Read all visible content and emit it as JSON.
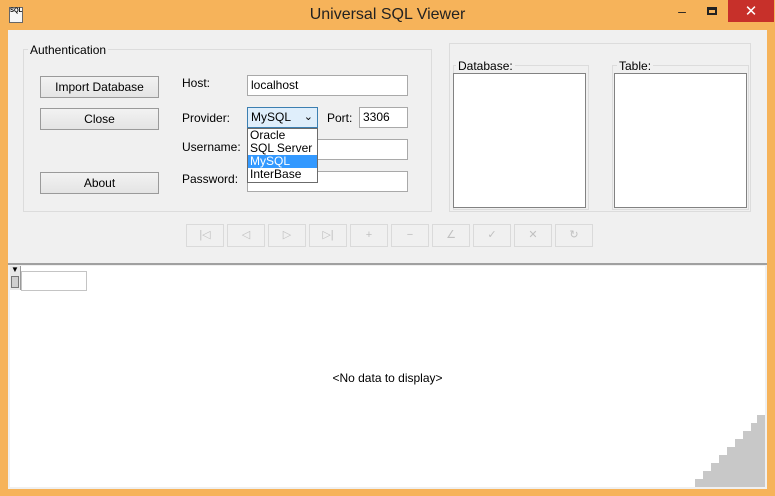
{
  "window": {
    "title": "Universal SQL Viewer",
    "app_icon_text": "SQL",
    "minimize": "–",
    "close": "✕"
  },
  "auth": {
    "group_label": "Authentication",
    "import_button": "Import Database",
    "close_button": "Close",
    "about_button": "About",
    "host_label": "Host:",
    "host_value": "localhost",
    "provider_label": "Provider:",
    "provider_value": "MySQL",
    "provider_options": [
      "Oracle",
      "SQL Server",
      "MySQL",
      "InterBase"
    ],
    "port_label": "Port:",
    "port_value": "3306",
    "username_label": "Username:",
    "username_value": "",
    "password_label": "Password:",
    "password_value": ""
  },
  "lists": {
    "database_label": "Database:",
    "table_label": "Table:"
  },
  "navigator": {
    "buttons": [
      "first-icon",
      "prior-icon",
      "next-icon",
      "last-icon",
      "insert-icon",
      "delete-icon",
      "edit-icon",
      "post-icon",
      "cancel-icon",
      "refresh-icon"
    ],
    "glyphs": [
      "|◁",
      "◁",
      "▷",
      "▷|",
      "+",
      "−",
      "∠",
      "✓",
      "✕",
      "↻"
    ]
  },
  "grid": {
    "empty_text": "<No data to display>"
  },
  "colors": {
    "frame": "#f6b35a",
    "close_button": "#c7302a",
    "selection": "#3399ff"
  }
}
